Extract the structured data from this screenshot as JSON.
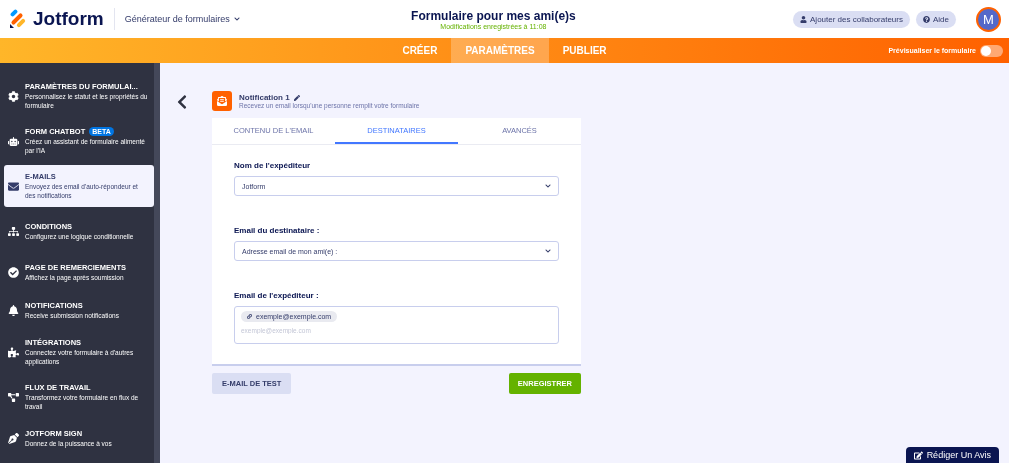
{
  "header": {
    "logo": "Jotform",
    "builder_menu": "Générateur de formulaires",
    "form_title": "Formulaire pour mes ami(e)s",
    "save_status": "Modifications enregistrées à 11:08",
    "collaborators_button": "Ajouter des collaborateurs",
    "help_button": "Aide",
    "avatar": "M"
  },
  "nav": {
    "tabs": [
      {
        "label": "CRÉER",
        "selected": false
      },
      {
        "label": "PARAMÈTRES",
        "selected": true
      },
      {
        "label": "PUBLIER",
        "selected": false
      }
    ],
    "preview_label": "Prévisualiser le formulaire",
    "preview_on": false
  },
  "sidebar": {
    "items": [
      {
        "kind": "gear",
        "title": "PARAMÈTRES DU FORMULAI...",
        "subtitle": "Personnalisez le statut et les propriétés du formulaire",
        "selected": false
      },
      {
        "kind": "chatbot",
        "title": "FORM CHATBOT",
        "badge": "BETA",
        "subtitle": "Créez un assistant de formulaire alimenté par l'IA",
        "selected": false
      },
      {
        "kind": "mail",
        "title": "E-MAILS",
        "subtitle": "Envoyez des email d'auto-répondeur et des notifications",
        "selected": true
      },
      {
        "kind": "tree",
        "title": "CONDITIONS",
        "subtitle": "Configurez une logique conditionnelle",
        "selected": false
      },
      {
        "kind": "check",
        "title": "PAGE DE REMERCIEMENTS",
        "subtitle": "Affichez la page après soumission",
        "selected": false
      },
      {
        "kind": "bell",
        "title": "NOTIFICATIONS",
        "subtitle": "Receive submission notifications",
        "selected": false
      },
      {
        "kind": "puzzle",
        "title": "INTÉGRATIONS",
        "subtitle": "Connectez votre formulaire à d'autres applications",
        "selected": false
      },
      {
        "kind": "flow",
        "title": "FLUX DE TRAVAIL",
        "subtitle": "Transformez votre formulaire en flux de travail",
        "selected": false
      },
      {
        "kind": "pen",
        "title": "JOTFORM SIGN",
        "subtitle": "Donnez de la puissance à vos",
        "selected": false
      }
    ]
  },
  "notification": {
    "title": "Notification 1",
    "description": "Recevez un email lorsqu'une personne remplit votre formulaire"
  },
  "tabs": [
    {
      "label": "CONTENU DE L'EMAIL",
      "selected": false
    },
    {
      "label": "DESTINATAIRES",
      "selected": true
    },
    {
      "label": "AVANCÉS",
      "selected": false
    }
  ],
  "fields": [
    {
      "kind": "select",
      "label": "Nom de l'expéditeur",
      "value": "Jotform"
    },
    {
      "kind": "select",
      "label": "Email du destinataire :",
      "value": "Adresse email de mon ami(e) :"
    },
    {
      "kind": "tags",
      "label": "Email de l'expéditeur :",
      "tags": [
        "exemple@exemple.com"
      ],
      "placeholder": "exemple@exemple.com"
    }
  ],
  "buttons": {
    "test": "E-MAIL DE TEST",
    "save": "ENREGISTRER"
  },
  "review_button": "Rédiger Un Avis"
}
